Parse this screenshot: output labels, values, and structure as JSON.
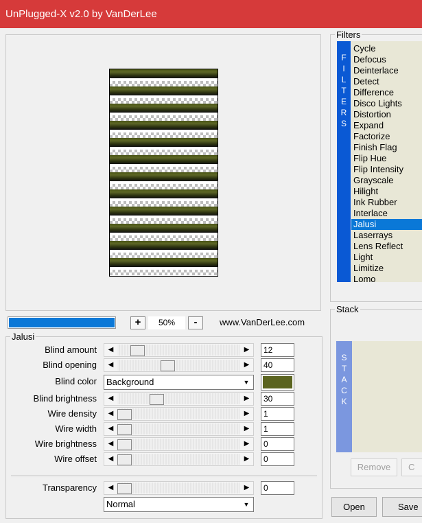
{
  "window": {
    "title": "UnPlugged-X v2.0 by VanDerLee"
  },
  "preview": {
    "zoom_in": "+",
    "zoom_out": "-",
    "zoom": "50%",
    "progress_fraction": 1.0,
    "website": "www.VanDerLee.com"
  },
  "params": {
    "group_title": "Jalusi",
    "rows": [
      {
        "label": "Blind amount",
        "value": "12",
        "fraction": 0.12
      },
      {
        "label": "Blind opening",
        "value": "40",
        "fraction": 0.4
      },
      {
        "label": "Blind brightness",
        "value": "30",
        "fraction": 0.3
      },
      {
        "label": "Wire density",
        "value": "1",
        "fraction": 0.0
      },
      {
        "label": "Wire width",
        "value": "1",
        "fraction": 0.0
      },
      {
        "label": "Wire brightness",
        "value": "0",
        "fraction": 0.0
      },
      {
        "label": "Wire offset",
        "value": "0",
        "fraction": 0.0
      }
    ],
    "blind_color": {
      "label": "Blind color",
      "value": "Background",
      "swatch": "#5b6420"
    },
    "transparency": {
      "label": "Transparency",
      "value": "0",
      "fraction": 0.0
    },
    "blend_mode": "Normal"
  },
  "filters": {
    "title": "Filters",
    "side_label": [
      "F",
      "I",
      "L",
      "T",
      "E",
      "R",
      "S"
    ],
    "items": [
      "Cycle",
      "Defocus",
      "Deinterlace",
      "Detect",
      "Difference",
      "Disco Lights",
      "Distortion",
      "Expand",
      "Factorize",
      "Finish Flag",
      "Flip Hue",
      "Flip Intensity",
      "Grayscale",
      "Hilight",
      "Ink Rubber",
      "Interlace",
      "Jalusi",
      "Laserrays",
      "Lens Reflect",
      "Light",
      "Limitize",
      "Lomo"
    ],
    "selected": "Jalusi"
  },
  "stack": {
    "title": "Stack",
    "side_label": [
      "S",
      "T",
      "A",
      "C",
      "K"
    ],
    "remove": "Remove",
    "clear": "C"
  },
  "actions": {
    "open": "Open",
    "save": "Save"
  },
  "colors": {
    "titlebar": "#d63a3a",
    "accent": "#0a78d7",
    "list_bg": "#e8e7d6"
  }
}
